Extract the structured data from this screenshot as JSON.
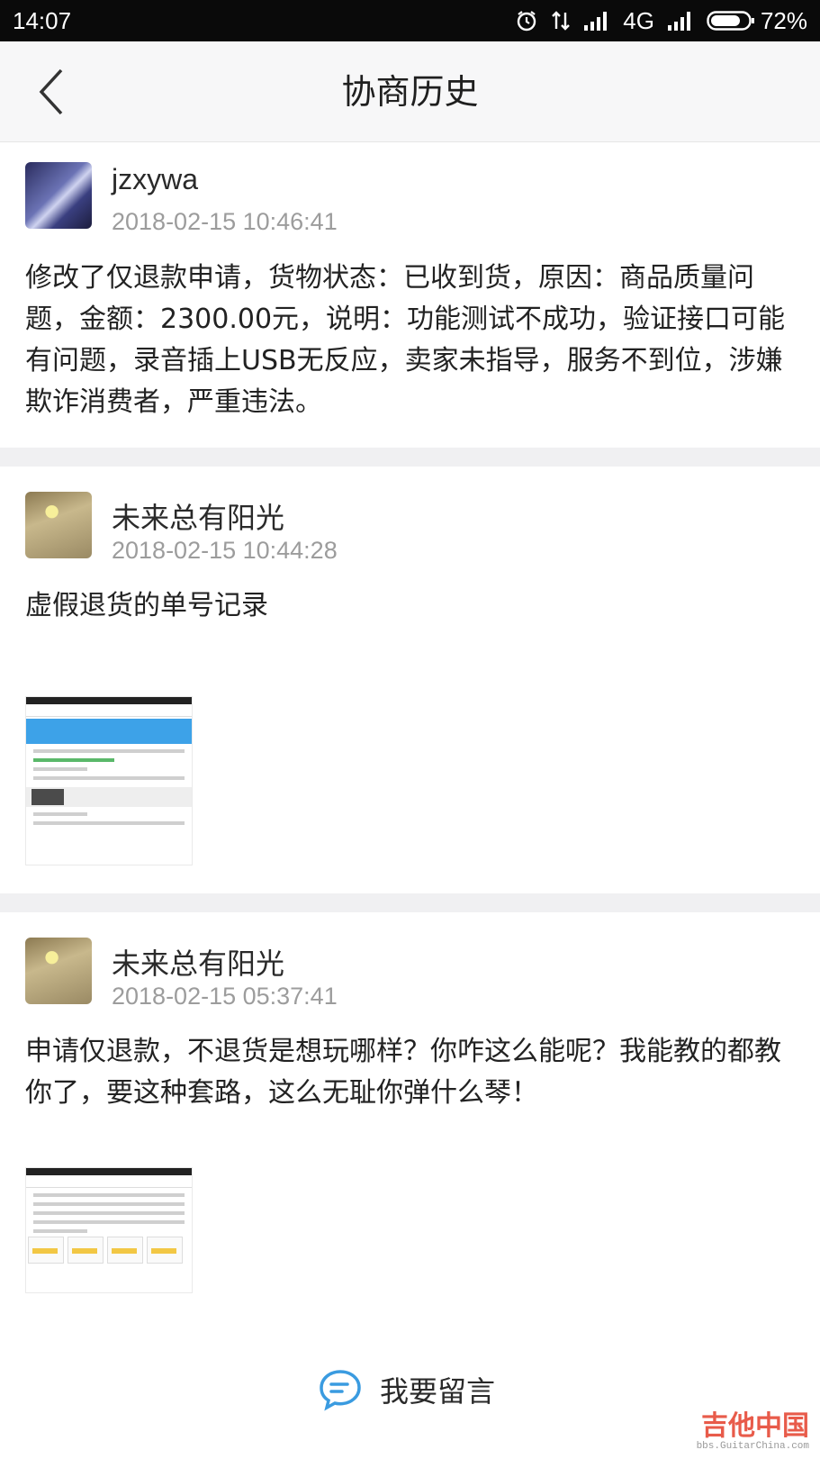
{
  "status_bar": {
    "time": "14:07",
    "network": "4G",
    "battery": "72%"
  },
  "header": {
    "title": "协商历史"
  },
  "entries": [
    {
      "user": "jzxywa",
      "time": "2018-02-15 10:46:41",
      "message": "修改了仅退款申请，货物状态：已收到货，原因：商品质量问题，金额：2300.00元，说明：功能测试不成功，验证接口可能有问题，录音插上USB无反应，卖家未指导，服务不到位，涉嫌欺诈消费者，严重违法。"
    },
    {
      "user": "未来总有阳光",
      "time": "2018-02-15 10:44:28",
      "message": "虚假退货的单号记录"
    },
    {
      "user": "未来总有阳光",
      "time": "2018-02-15 05:37:41",
      "message": "申请仅退款，不退货是想玩哪样？你咋这么能呢？我能教的都教你了，要这种套路，这么无耻你弹什么琴！"
    }
  ],
  "footer": {
    "comment_label": "我要留言"
  },
  "watermark": {
    "text": "吉他中国",
    "sub": "bbs.GuitarChina.com"
  },
  "colors": {
    "accent": "#3a9be0",
    "status_bar_bg": "#0a0a0a",
    "header_bg": "#f7f7f8"
  }
}
